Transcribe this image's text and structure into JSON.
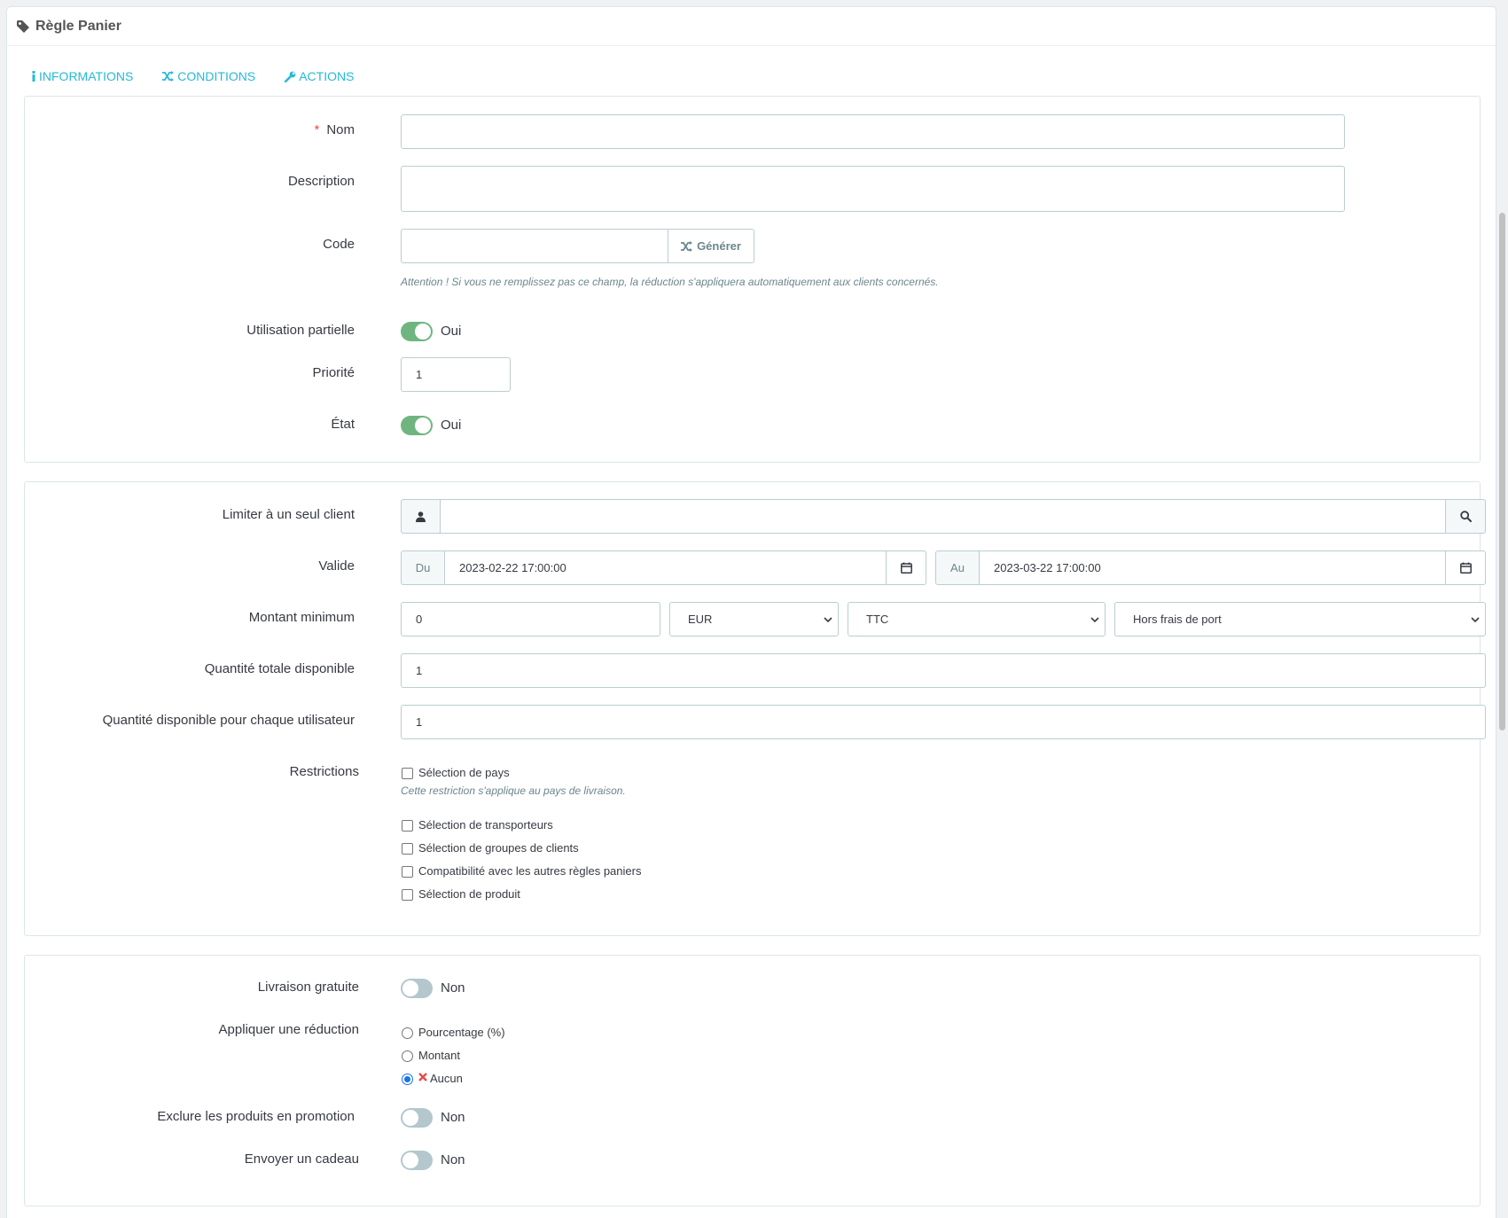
{
  "panel": {
    "title": "Règle Panier"
  },
  "tabs": [
    "INFORMATIONS",
    "CONDITIONS",
    "ACTIONS"
  ],
  "info": {
    "name_label": "Nom",
    "name_value": "",
    "description_label": "Description",
    "description_value": "",
    "code_label": "Code",
    "code_value": "",
    "generate_label": "Générer",
    "code_help": "Attention ! Si vous ne remplissez pas ce champ, la réduction s'appliquera automatiquement aux clients concernés.",
    "partial_use_label": "Utilisation partielle",
    "partial_use_state": "Oui",
    "priority_label": "Priorité",
    "priority_value": "1",
    "status_label": "État",
    "status_state": "Oui"
  },
  "conditions": {
    "customer_label": "Limiter à un seul client",
    "customer_value": "",
    "valid_label": "Valide",
    "from_label": "Du",
    "from_value": "2023-02-22 17:00:00",
    "to_label": "Au",
    "to_value": "2023-03-22 17:00:00",
    "min_amount_label": "Montant minimum",
    "min_amount_value": "0",
    "currency_selected": "EUR",
    "tax_selected": "TTC",
    "shipping_selected": "Hors frais de port",
    "total_qty_label": "Quantité totale disponible",
    "total_qty_value": "1",
    "user_qty_label": "Quantité disponible pour chaque utilisateur",
    "user_qty_value": "1",
    "restrictions_label": "Restrictions",
    "restrictions": [
      "Sélection de pays",
      "Sélection de transporteurs",
      "Sélection de groupes de clients",
      "Compatibilité avec les autres règles paniers",
      "Sélection de produit"
    ],
    "country_help": "Cette restriction s'applique au pays de livraison."
  },
  "actions": {
    "free_shipping_label": "Livraison gratuite",
    "free_shipping_state": "Non",
    "discount_label": "Appliquer une réduction",
    "discount_options": [
      "Pourcentage (%)",
      "Montant",
      "Aucun"
    ],
    "discount_selected": "Aucun",
    "exclude_label": "Exclure les produits en promotion",
    "exclude_state": "Non",
    "gift_label": "Envoyer un cadeau",
    "gift_state": "Non"
  },
  "colors": {
    "accent": "#25b9d7",
    "switch_on": "#70b580",
    "switch_off": "#b3c7cd",
    "required": "#e84a4a",
    "none_icon": "#e84a4a"
  }
}
